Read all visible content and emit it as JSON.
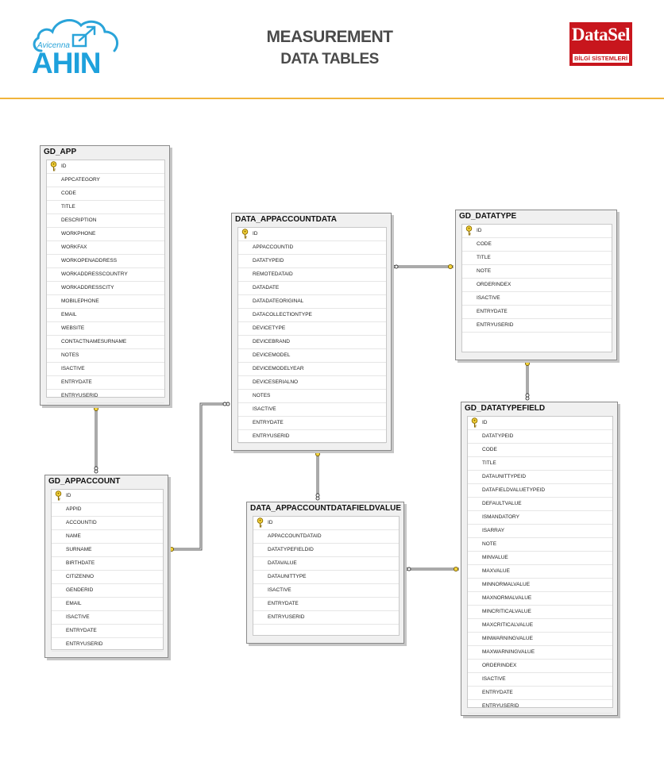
{
  "header": {
    "title_line1": "MEASUREMENT",
    "title_line2": "DATA TABLES",
    "logo_left": {
      "small": "Avicenna",
      "big": "AHIN",
      "color": "#1ea1dc"
    },
    "logo_right": {
      "word": "DataSel",
      "sub": "BİLGİ SİSTEMLERİ",
      "color": "#c8161d"
    }
  },
  "accent_color": "#f0b43c",
  "diagram": {
    "tables": [
      {
        "name": "GD_APP",
        "key": "ID",
        "columns": [
          "APPCATEGORY",
          "CODE",
          "TITLE",
          "DESCRIPTION",
          "WORKPHONE",
          "WORKFAX",
          "WORKOPENADDRESS",
          "WORKADDRESSCOUNTRY",
          "WORKADDRESSCITY",
          "MOBILEPHONE",
          "EMAIL",
          "WEBSITE",
          "CONTACTNAMESURNAME",
          "NOTES",
          "ISACTIVE",
          "ENTRYDATE",
          "ENTRYUSERID"
        ]
      },
      {
        "name": "DATA_APPACCOUNTDATA",
        "key": "ID",
        "columns": [
          "APPACCOUNTID",
          "DATATYPEID",
          "REMOTEDATAID",
          "DATADATE",
          "DATADATEORIGINAL",
          "DATACOLLECTIONTYPE",
          "DEVICETYPE",
          "DEVICEBRAND",
          "DEVICEMODEL",
          "DEVICEMODELYEAR",
          "DEVICESERIALNO",
          "NOTES",
          "ISACTIVE",
          "ENTRYDATE",
          "ENTRYUSERID"
        ]
      },
      {
        "name": "GD_DATATYPE",
        "key": "ID",
        "columns": [
          "CODE",
          "TITLE",
          "NOTE",
          "ORDERINDEX",
          "ISACTIVE",
          "ENTRYDATE",
          "ENTRYUSERID"
        ]
      },
      {
        "name": "GD_APPACCOUNT",
        "key": "ID",
        "columns": [
          "APPID",
          "ACCOUNTID",
          "NAME",
          "SURNAME",
          "BIRTHDATE",
          "CITIZENNO",
          "GENDERID",
          "EMAIL",
          "ISACTIVE",
          "ENTRYDATE",
          "ENTRYUSERID"
        ]
      },
      {
        "name": "DATA_APPACCOUNTDATAFIELDVALUE",
        "key": "ID",
        "columns": [
          "APPACCOUNTDATAID",
          "DATATYPEFIELDID",
          "DATAVALUE",
          "DATAUNITTYPE",
          "ISACTIVE",
          "ENTRYDATE",
          "ENTRYUSERID"
        ]
      },
      {
        "name": "GD_DATATYPEFIELD",
        "key": "ID",
        "columns": [
          "DATATYPEID",
          "CODE",
          "TITLE",
          "DATAUNITTYPEID",
          "DATAFIELDVALUETYPEID",
          "DEFAULTVALUE",
          "ISMANDATORY",
          "ISARRAY",
          "NOTE",
          "MINVALUE",
          "MAXVALUE",
          "MINNORMALVALUE",
          "MAXNORMALVALUE",
          "MINCRITICALVALUE",
          "MAXCRITICALVALUE",
          "MINWARNINGVALUE",
          "MAXWARNINGVALUE",
          "ORDERINDEX",
          "ISACTIVE",
          "ENTRYDATE",
          "ENTRYUSERID"
        ]
      }
    ],
    "relationships": [
      {
        "from": "GD_APP",
        "to": "GD_APPACCOUNT"
      },
      {
        "from": "GD_APPACCOUNT",
        "to": "DATA_APPACCOUNTDATA"
      },
      {
        "from": "GD_DATATYPE",
        "to": "DATA_APPACCOUNTDATA"
      },
      {
        "from": "DATA_APPACCOUNTDATA",
        "to": "DATA_APPACCOUNTDATAFIELDVALUE"
      },
      {
        "from": "GD_DATATYPE",
        "to": "GD_DATATYPEFIELD"
      },
      {
        "from": "GD_DATATYPEFIELD",
        "to": "DATA_APPACCOUNTDATAFIELDVALUE"
      }
    ]
  }
}
